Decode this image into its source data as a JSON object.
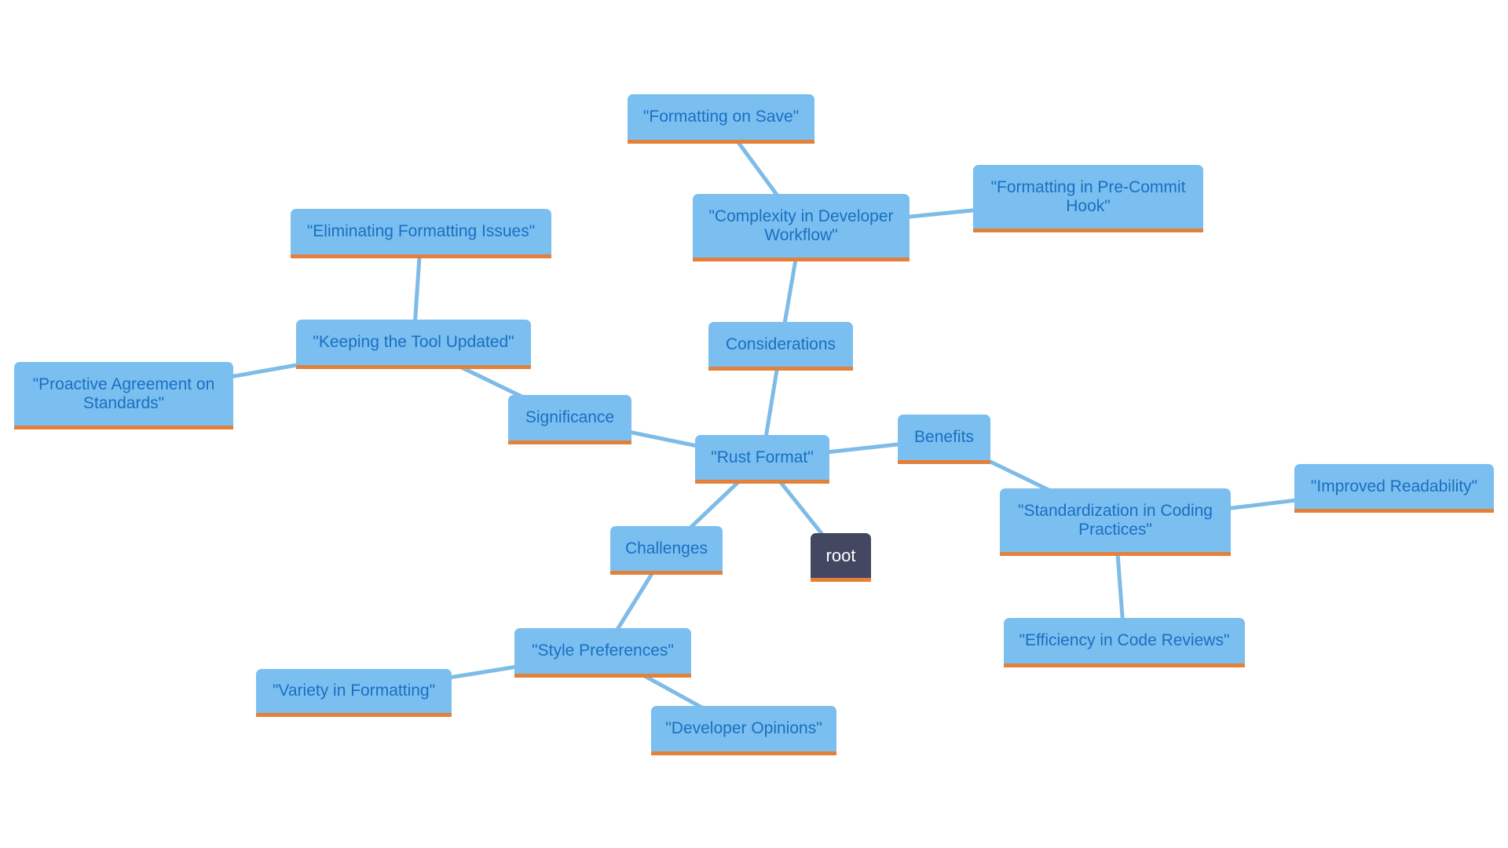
{
  "diagram": {
    "type": "mindmap",
    "colors": {
      "node_fill": "#7bbff0",
      "node_text": "#1a6fc2",
      "node_underline": "#e3813a",
      "edge": "#7ebbe6",
      "root_fill": "#434761",
      "root_text": "#ffffff"
    },
    "nodes": {
      "rust_format": "\"Rust Format\"",
      "root": "root",
      "considerations": "Considerations",
      "complexity": "\"Complexity in Developer Workflow\"",
      "formatting_on_save": "\"Formatting on Save\"",
      "pre_commit": "\"Formatting in Pre-Commit Hook\"",
      "significance": "Significance",
      "keeping_updated": "\"Keeping the Tool Updated\"",
      "eliminating_issues": "\"Eliminating Formatting Issues\"",
      "proactive_agreement": "\"Proactive Agreement on Standards\"",
      "benefits": "Benefits",
      "standardization": "\"Standardization in Coding Practices\"",
      "improved_readability": "\"Improved Readability\"",
      "efficiency_reviews": "\"Efficiency in Code Reviews\"",
      "challenges": "Challenges",
      "style_preferences": "\"Style Preferences\"",
      "variety_formatting": "\"Variety in Formatting\"",
      "developer_opinions": "\"Developer Opinions\""
    },
    "edges": [
      [
        "rust_format",
        "root"
      ],
      [
        "rust_format",
        "considerations"
      ],
      [
        "considerations",
        "complexity"
      ],
      [
        "complexity",
        "formatting_on_save"
      ],
      [
        "complexity",
        "pre_commit"
      ],
      [
        "rust_format",
        "significance"
      ],
      [
        "significance",
        "keeping_updated"
      ],
      [
        "keeping_updated",
        "eliminating_issues"
      ],
      [
        "keeping_updated",
        "proactive_agreement"
      ],
      [
        "rust_format",
        "benefits"
      ],
      [
        "benefits",
        "standardization"
      ],
      [
        "standardization",
        "improved_readability"
      ],
      [
        "standardization",
        "efficiency_reviews"
      ],
      [
        "rust_format",
        "challenges"
      ],
      [
        "challenges",
        "style_preferences"
      ],
      [
        "style_preferences",
        "variety_formatting"
      ],
      [
        "style_preferences",
        "developer_opinions"
      ]
    ]
  }
}
